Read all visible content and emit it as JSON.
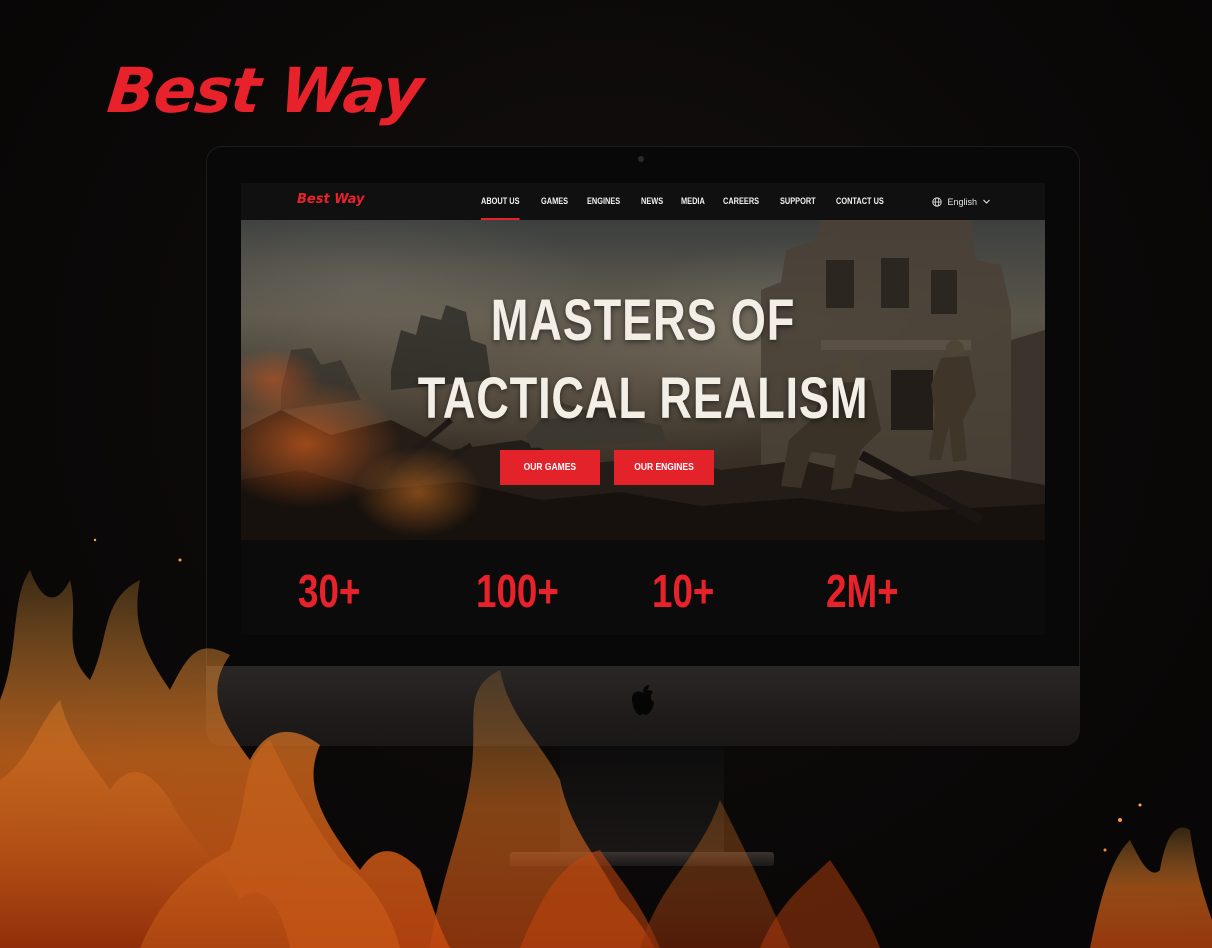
{
  "brand": {
    "name": "Best Way",
    "accent_color": "#e8222b"
  },
  "site": {
    "logo": "Best Way",
    "nav": {
      "items": [
        {
          "label": "ABOUT US",
          "active": true
        },
        {
          "label": "GAMES"
        },
        {
          "label": "ENGINES"
        },
        {
          "label": "NEWS"
        },
        {
          "label": "MEDIA"
        },
        {
          "label": "CAREERS"
        },
        {
          "label": "SUPPORT"
        },
        {
          "label": "CONTACT US"
        }
      ],
      "language": "English",
      "language_icon": "globe-icon",
      "language_chevron": "chevron-down-icon"
    },
    "hero": {
      "title_line1": "MASTERS OF",
      "title_line2": "TACTICAL REALISM",
      "buttons": {
        "games": "OUR GAMES",
        "engines": "OUR ENGINES"
      }
    },
    "stats": [
      {
        "value": "30+"
      },
      {
        "value": "100+"
      },
      {
        "value": "10+"
      },
      {
        "value": "2M+"
      }
    ]
  },
  "device": {
    "logo_icon": "apple-icon"
  }
}
